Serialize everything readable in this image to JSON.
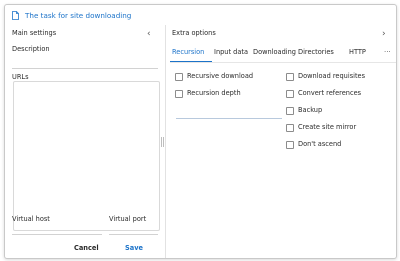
{
  "window": {
    "title": "The task for site downloading"
  },
  "left_panel": {
    "header": "Main settings",
    "collapse_glyph": "‹",
    "description_label": "Description",
    "urls_label": "URLs",
    "virtual_host_label": "Virtual host",
    "virtual_port_label": "Virtual port",
    "cancel_label": "Cancel",
    "save_label": "Save"
  },
  "right_panel": {
    "header": "Extra options",
    "expand_glyph": "›",
    "tabs": [
      {
        "label": "Recursion",
        "active": true
      },
      {
        "label": "Input data",
        "active": false
      },
      {
        "label": "Downloading",
        "active": false
      },
      {
        "label": "Directories",
        "active": false
      },
      {
        "label": "HTTP",
        "active": false
      }
    ],
    "more_label": "···",
    "left_options": [
      {
        "label": "Recursive download",
        "checked": false
      },
      {
        "label": "Recursion depth",
        "checked": false
      }
    ],
    "right_options": [
      {
        "label": "Download requisites",
        "checked": false
      },
      {
        "label": "Convert references",
        "checked": false
      },
      {
        "label": "Backup",
        "checked": false
      },
      {
        "label": "Create site mirror",
        "checked": false
      },
      {
        "label": "Don't ascend",
        "checked": false
      }
    ]
  },
  "colors": {
    "accent": "#1c73c9",
    "border": "#c9c9c9",
    "text": "#2b2b2b"
  },
  "icons": {
    "title_icon": "document-icon"
  }
}
